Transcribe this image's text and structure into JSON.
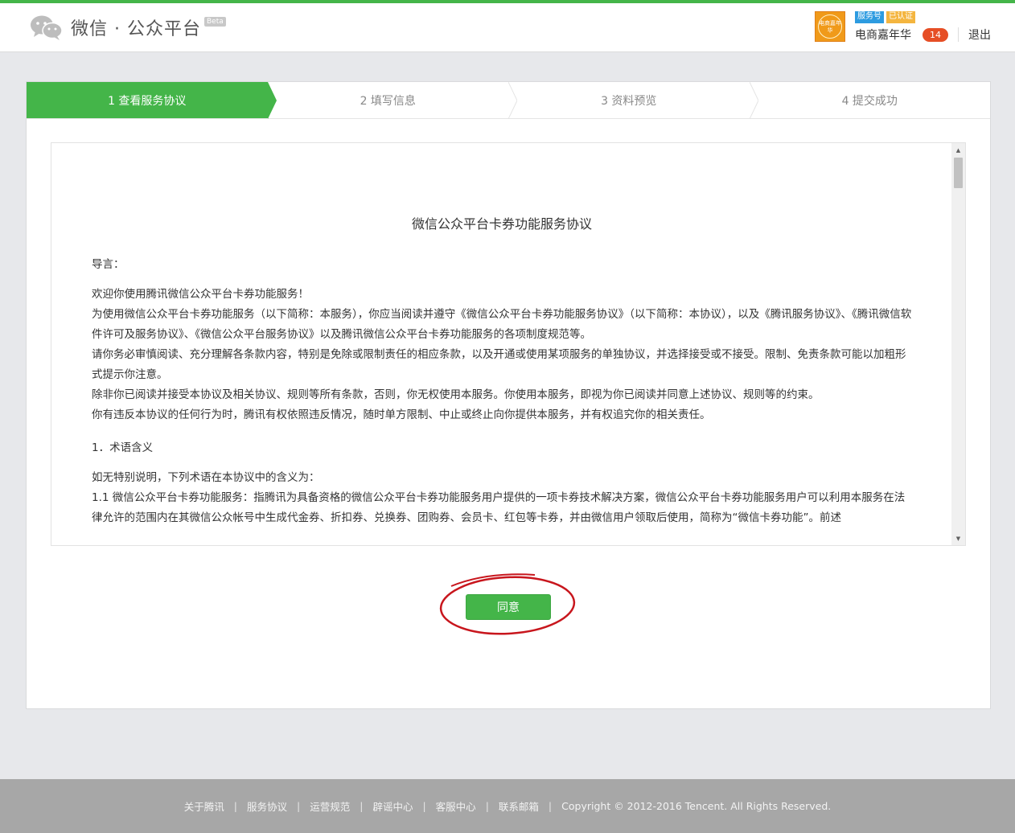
{
  "header": {
    "brand": "微信 · 公众平台",
    "beta": "Beta",
    "avatar_text": "电商嘉年华",
    "badge_service": "服务号",
    "badge_verified": "已认证",
    "account_name": "电商嘉年华",
    "message_count": "14",
    "logout": "退出"
  },
  "steps": [
    {
      "label": "1 查看服务协议",
      "active": true
    },
    {
      "label": "2 填写信息",
      "active": false
    },
    {
      "label": "3 资料预览",
      "active": false
    },
    {
      "label": "4 提交成功",
      "active": false
    }
  ],
  "agreement": {
    "title": "微信公众平台卡券功能服务协议",
    "intro_heading": "导言：",
    "paragraphs": [
      "欢迎你使用腾讯微信公众平台卡券功能服务！",
      "为使用微信公众平台卡券功能服务（以下简称：本服务），你应当阅读并遵守《微信公众平台卡券功能服务协议》（以下简称：本协议），以及《腾讯服务协议》、《腾讯微信软件许可及服务协议》、《微信公众平台服务协议》以及腾讯微信公众平台卡券功能服务的各项制度规范等。",
      "请你务必审慎阅读、充分理解各条款内容，特别是免除或限制责任的相应条款，以及开通或使用某项服务的单独协议，并选择接受或不接受。限制、免责条款可能以加粗形式提示你注意。",
      "除非你已阅读并接受本协议及相关协议、规则等所有条款，否则，你无权使用本服务。你使用本服务，即视为你已阅读并同意上述协议、规则等的约束。",
      "你有违反本协议的任何行为时，腾讯有权依照违反情况，随时单方限制、中止或终止向你提供本服务，并有权追究你的相关责任。"
    ],
    "section1_heading": "1．术语含义",
    "section1_intro": "如无特别说明，下列术语在本协议中的含义为：",
    "section1_item1": "1.1 微信公众平台卡券功能服务：指腾讯为具备资格的微信公众平台卡券功能服务用户提供的一项卡券技术解决方案，微信公众平台卡券功能服务用户可以利用本服务在法律允许的范围内在其微信公众帐号中生成代金券、折扣券、兑换券、团购券、会员卡、红包等卡券，并由微信用户领取后使用，简称为“微信卡券功能”。前述"
  },
  "agree_button": "同意",
  "footer": {
    "links": [
      "关于腾讯",
      "服务协议",
      "运营规范",
      "辟谣中心",
      "客服中心",
      "联系邮箱"
    ],
    "copyright": "Copyright © 2012-2016 Tencent. All Rights Reserved."
  },
  "colors": {
    "accent": "#44b549",
    "highlight_ring": "#c8161d"
  }
}
